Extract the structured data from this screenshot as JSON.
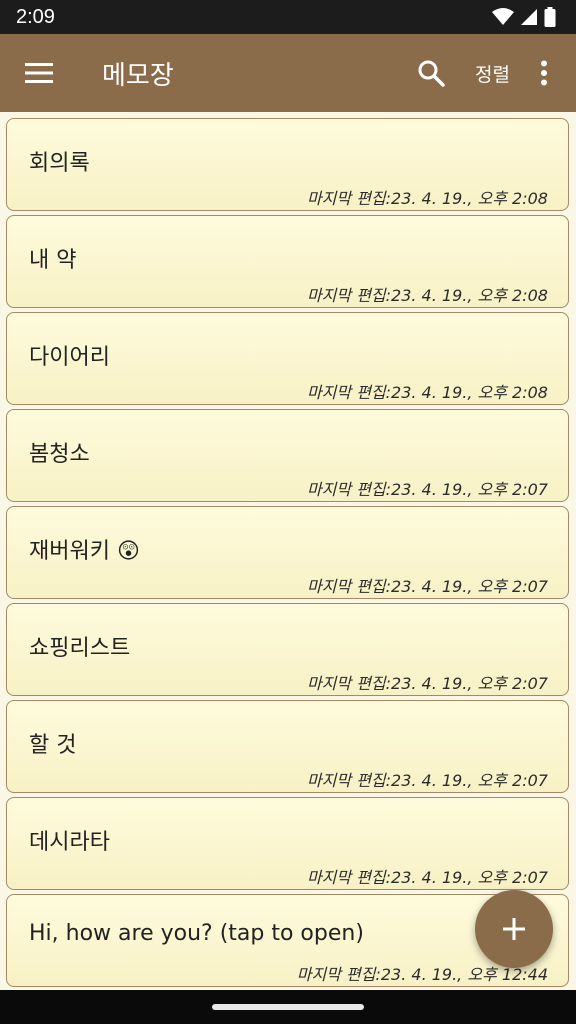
{
  "status_bar": {
    "time": "2:09"
  },
  "app_bar": {
    "title": "메모장",
    "sort_label": "정렬"
  },
  "memos": [
    {
      "title": "회의록",
      "meta": "마지막 편집:23. 4. 19., 오후 2:08"
    },
    {
      "title": "내 약",
      "meta": "마지막 편집:23. 4. 19., 오후 2:08"
    },
    {
      "title": "다이어리",
      "meta": "마지막 편집:23. 4. 19., 오후 2:08"
    },
    {
      "title": "봄청소",
      "meta": "마지막 편집:23. 4. 19., 오후 2:07"
    },
    {
      "title": "재버워키 😲",
      "meta": "마지막 편집:23. 4. 19., 오후 2:07"
    },
    {
      "title": "쇼핑리스트",
      "meta": "마지막 편집:23. 4. 19., 오후 2:07"
    },
    {
      "title": "할 것",
      "meta": "마지막 편집:23. 4. 19., 오후 2:07"
    },
    {
      "title": "데시라타",
      "meta": "마지막 편집:23. 4. 19., 오후 2:07"
    },
    {
      "title": "Hi, how are you? (tap to open)",
      "meta": "마지막 편집:23. 4. 19., 오후 12:44"
    }
  ],
  "colors": {
    "app_bar": "#8a6b4a",
    "card_bg": "#fefbdc",
    "card_border": "#a48a63",
    "fab": "#8a6b4a"
  },
  "icons": {
    "menu": "hamburger-menu-icon",
    "search": "search-icon",
    "more": "more-vert-icon",
    "fab": "plus-icon"
  }
}
